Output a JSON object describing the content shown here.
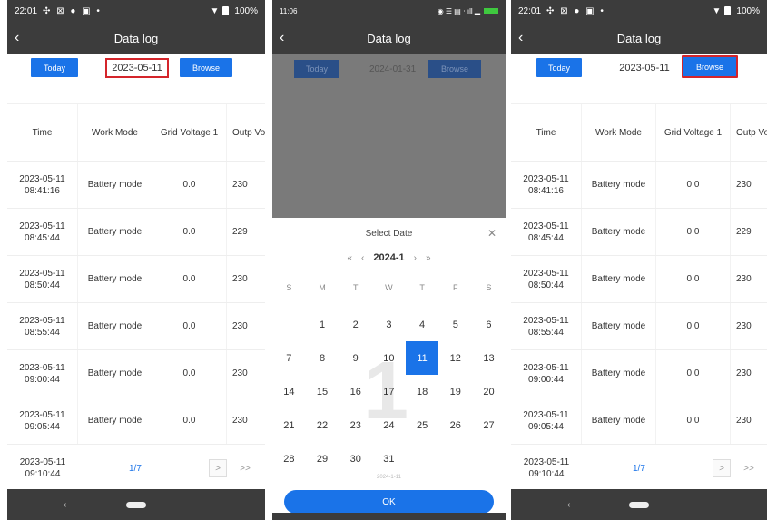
{
  "phone1": {
    "status": {
      "time": "22:01",
      "icons": "✣ ⊠ ● ▣ •",
      "battery": "100%"
    },
    "title": "Data log",
    "today_label": "Today",
    "date_value": "2023-05-11",
    "browse_label": "Browse",
    "columns": [
      "Time",
      "Work Mode",
      "Grid Voltage 1",
      "Outp Volta"
    ],
    "rows": [
      {
        "date": "2023-05-11",
        "time": "08:41:16",
        "mode": "Battery mode",
        "grid": "0.0",
        "out": "230"
      },
      {
        "date": "2023-05-11",
        "time": "08:45:44",
        "mode": "Battery mode",
        "grid": "0.0",
        "out": "229"
      },
      {
        "date": "2023-05-11",
        "time": "08:50:44",
        "mode": "Battery mode",
        "grid": "0.0",
        "out": "230"
      },
      {
        "date": "2023-05-11",
        "time": "08:55:44",
        "mode": "Battery mode",
        "grid": "0.0",
        "out": "230"
      },
      {
        "date": "2023-05-11",
        "time": "09:00:44",
        "mode": "Battery mode",
        "grid": "0.0",
        "out": "230"
      },
      {
        "date": "2023-05-11",
        "time": "09:05:44",
        "mode": "Battery mode",
        "grid": "0.0",
        "out": "230"
      }
    ],
    "last_row": {
      "date": "2023-05-11",
      "time": "09:10:44"
    },
    "page": "1/7",
    "next": ">",
    "last": ">>"
  },
  "phone2": {
    "status": {
      "time": "11:06",
      "icons": "◉ ☰ ▤ ‧ ıll ▂"
    },
    "title": "Data log",
    "today_label": "Today",
    "date_value": "2024-01-31",
    "browse_label": "Browse",
    "sheet_title": "Select Date",
    "close": "✕",
    "month_label": "2024-1",
    "nav": {
      "prev_year": "«",
      "prev_month": "‹",
      "next_month": "›",
      "next_year": "»"
    },
    "weekdays": [
      "S",
      "M",
      "T",
      "W",
      "T",
      "F",
      "S"
    ],
    "weeks": [
      [
        "",
        "1",
        "2",
        "3",
        "4",
        "5",
        "6"
      ],
      [
        "7",
        "8",
        "9",
        "10",
        "11",
        "12",
        "13"
      ],
      [
        "14",
        "15",
        "16",
        "17",
        "18",
        "19",
        "20"
      ],
      [
        "21",
        "22",
        "23",
        "24",
        "25",
        "26",
        "27"
      ],
      [
        "28",
        "29",
        "30",
        "31",
        "",
        "",
        ""
      ]
    ],
    "selected_day": "11",
    "watermark": "1",
    "selected_note": "2024-1-11",
    "ok_label": "OK"
  },
  "phone3": {
    "status": {
      "time": "22:01",
      "icons": "✣ ⊠ ● ▣ •",
      "battery": "100%"
    },
    "title": "Data log",
    "today_label": "Today",
    "date_value": "2023-05-11",
    "browse_label": "Browse",
    "columns": [
      "Time",
      "Work Mode",
      "Grid Voltage 1",
      "Outp Volta"
    ],
    "rows": [
      {
        "date": "2023-05-11",
        "time": "08:41:16",
        "mode": "Battery mode",
        "grid": "0.0",
        "out": "230"
      },
      {
        "date": "2023-05-11",
        "time": "08:45:44",
        "mode": "Battery mode",
        "grid": "0.0",
        "out": "229"
      },
      {
        "date": "2023-05-11",
        "time": "08:50:44",
        "mode": "Battery mode",
        "grid": "0.0",
        "out": "230"
      },
      {
        "date": "2023-05-11",
        "time": "08:55:44",
        "mode": "Battery mode",
        "grid": "0.0",
        "out": "230"
      },
      {
        "date": "2023-05-11",
        "time": "09:00:44",
        "mode": "Battery mode",
        "grid": "0.0",
        "out": "230"
      },
      {
        "date": "2023-05-11",
        "time": "09:05:44",
        "mode": "Battery mode",
        "grid": "0.0",
        "out": "230"
      }
    ],
    "last_row": {
      "date": "2023-05-11",
      "time": "09:10:44"
    },
    "page": "1/7",
    "next": ">",
    "last": ">>"
  },
  "colors": {
    "accent": "#1a73e8",
    "highlight": "#d4252b",
    "bar": "#3c3c3c"
  }
}
